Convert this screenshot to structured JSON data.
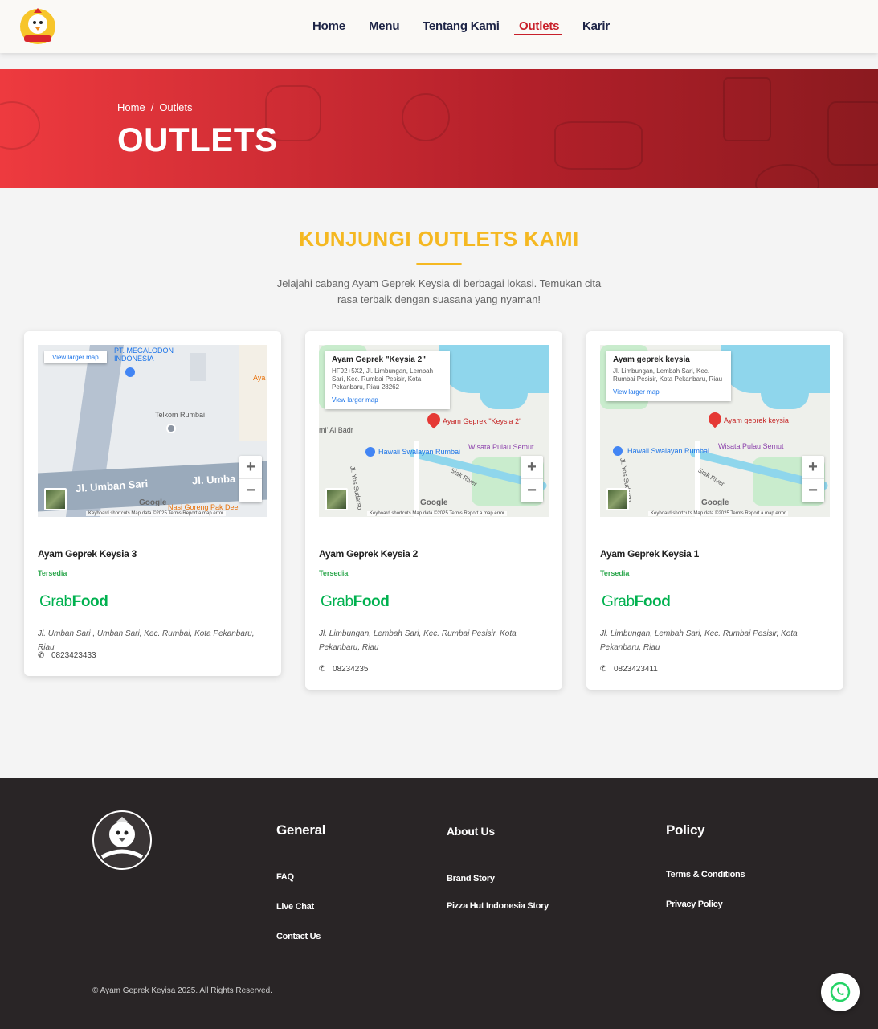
{
  "header": {
    "logo_icon": "chicken-mascot-logo",
    "nav": [
      {
        "label": "Home",
        "active": false
      },
      {
        "label": "Menu",
        "active": false
      },
      {
        "label": "Tentang Kami",
        "active": false
      },
      {
        "label": "Outlets",
        "active": true
      },
      {
        "label": "Karir",
        "active": false
      }
    ]
  },
  "hero": {
    "breadcrumb": {
      "home": "Home",
      "separator": "/",
      "current": "Outlets"
    },
    "title": "OUTLETS"
  },
  "section": {
    "title": "KUNJUNGI OUTLETS KAMI",
    "description": "Jelajahi cabang Ayam Geprek Keysia di berbagai lokasi. Temukan cita rasa terbaik dengan suasana yang nyaman!"
  },
  "outlets": [
    {
      "map": {
        "larger_map_link": "View larger map",
        "labels": [
          "PT. MEGALODON INDONESIA",
          "Telkom Rumbai",
          "Jl. Umban Sari",
          "Jl. Umba",
          "Nasi Goreng Pak Dee",
          "Aya"
        ],
        "google": "Google",
        "footer": "Keyboard shortcuts   Map data ©2025   Terms   Report a map error"
      },
      "name": "Ayam Geprek Keysia 3",
      "status": "Tersedia",
      "delivery": {
        "grab": "Grab",
        "food": "Food"
      },
      "address": "Jl. Umban Sari , Umban Sari, Kec. Rumbai, Kota Pekanbaru, Riau",
      "phone": "0823423433"
    },
    {
      "map": {
        "popup_title": "Ayam Geprek \"Keysia 2\"",
        "popup_address": "HF92+5X2, Jl. Limbungan, Lembah Sari, Kec. Rumbai Pesisir, Kota Pekanbaru, Riau 28262",
        "larger_map_link": "View larger map",
        "pin_label": "Ayam Geprek \"Keysia 2\"",
        "labels": [
          "mi' Al Badr",
          "Hawaii Swalayan Rumbai",
          "Wisata Pulau Semut",
          "Jl. Yos Sudarso",
          "Siak River"
        ],
        "google": "Google",
        "footer": "Keyboard shortcuts   Map data ©2025   Terms   Report a map error"
      },
      "name": "Ayam Geprek Keysia 2",
      "status": "Tersedia",
      "delivery": {
        "grab": "Grab",
        "food": "Food"
      },
      "address": "Jl. Limbungan, Lembah Sari, Kec. Rumbai Pesisir, Kota Pekanbaru, Riau",
      "phone": "08234235"
    },
    {
      "map": {
        "popup_title": "Ayam geprek keysia",
        "popup_address": "Jl. Limbungan, Lembah Sari, Kec. Rumbai Pesisir, Kota Pekanbaru, Riau",
        "larger_map_link": "View larger map",
        "pin_label": "Ayam geprek keysia",
        "labels": [
          "Hawaii Swalayan Rumbai",
          "Wisata Pulau Semut",
          "Jl. Yos Sudarso",
          "Siak River"
        ],
        "google": "Google",
        "footer": "Keyboard shortcuts   Map data ©2025   Terms   Report a map error"
      },
      "name": "Ayam Geprek Keysia 1",
      "status": "Tersedia",
      "delivery": {
        "grab": "Grab",
        "food": "Food"
      },
      "address": "Jl. Limbungan, Lembah Sari, Kec. Rumbai Pesisir, Kota Pekanbaru, Riau",
      "phone": "0823423411"
    }
  ],
  "footer": {
    "logo_icon": "ayam-geprek-keysia-logo",
    "columns": [
      {
        "title": "General",
        "links": [
          "FAQ",
          "Live Chat",
          "Contact Us"
        ]
      },
      {
        "title": "About Us",
        "links": [
          "Brand Story",
          "Pizza Hut Indonesia Story"
        ]
      },
      {
        "title": "Policy",
        "links": [
          "Terms & Conditions",
          "Privacy Policy"
        ]
      }
    ],
    "copyright": "© Ayam Geprek Keyisa 2025. All Rights Reserved."
  },
  "whatsapp_icon": "whatsapp-icon",
  "colors": {
    "brand_red": "#c8202a",
    "accent_yellow": "#f5b821",
    "grab_green": "#00b14f",
    "footer_bg": "#292526"
  }
}
